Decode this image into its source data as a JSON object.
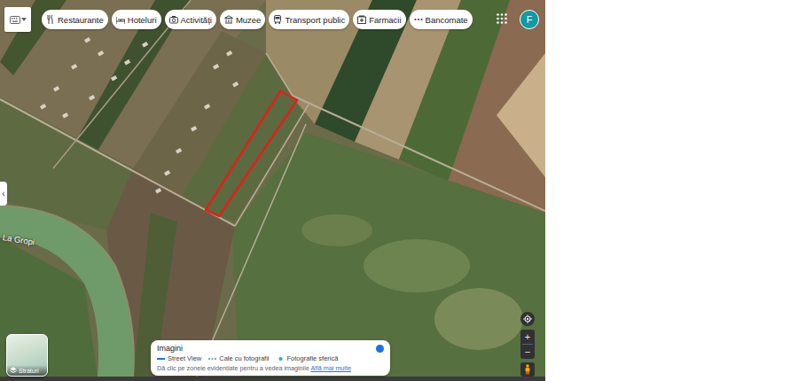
{
  "chips": [
    {
      "label": "Restaurante"
    },
    {
      "label": "Hoteluri"
    },
    {
      "label": "Activități"
    },
    {
      "label": "Muzee"
    },
    {
      "label": "Transport public"
    },
    {
      "label": "Farmacii"
    },
    {
      "label": "Bancomate"
    }
  ],
  "account": {
    "initial": "F"
  },
  "sidebar_toggle": {
    "icon": "‹"
  },
  "map": {
    "labels": [
      {
        "text": "La Gropi"
      }
    ]
  },
  "layers_button": {
    "label": "Straturi"
  },
  "imagery_panel": {
    "title": "Imagini",
    "enabled": true,
    "legend": [
      {
        "label": "Street View",
        "kind": "line",
        "color": "#1a73e8"
      },
      {
        "label": "Cale cu fotografii",
        "kind": "dashed",
        "color": "#4a86d8"
      },
      {
        "label": "Fotografie sferică",
        "kind": "dot",
        "color": "#3aa3d4"
      }
    ],
    "hint": "Dă clic pe zonele evidențiate pentru a vedea imaginile",
    "link": "Află mai multe"
  },
  "zoom": {
    "in": "+",
    "out": "−"
  }
}
